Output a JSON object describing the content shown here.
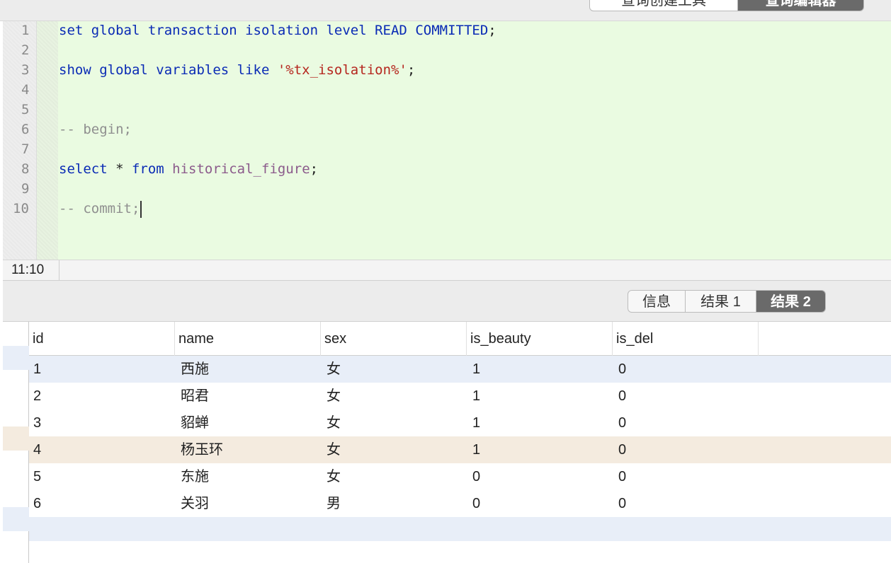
{
  "top_tabs": [
    {
      "label": "查询创建工具",
      "active": false
    },
    {
      "label": "查询编辑器",
      "active": true
    }
  ],
  "editor": {
    "line_numbers": [
      "1",
      "2",
      "3",
      "4",
      "5",
      "6",
      "7",
      "8",
      "9",
      "10"
    ],
    "lines": [
      [
        {
          "t": "set global transaction isolation level READ COMMITTED",
          "c": "kw"
        },
        {
          "t": ";",
          "c": "punc"
        }
      ],
      [],
      [
        {
          "t": "show global variables like ",
          "c": "kw"
        },
        {
          "t": "'%tx_isolation%'",
          "c": "str"
        },
        {
          "t": ";",
          "c": "punc"
        }
      ],
      [],
      [],
      [
        {
          "t": "-- begin;",
          "c": "cm"
        }
      ],
      [],
      [
        {
          "t": "select ",
          "c": "kw"
        },
        {
          "t": "* ",
          "c": "punc"
        },
        {
          "t": "from ",
          "c": "kw"
        },
        {
          "t": "historical_figure",
          "c": "id"
        },
        {
          "t": ";",
          "c": "punc"
        }
      ],
      [],
      [
        {
          "t": "-- commit;",
          "c": "cm"
        }
      ]
    ],
    "caret_line": 9
  },
  "status": {
    "cursor_position": "11:10"
  },
  "result_tabs": [
    {
      "label": "信息",
      "active": false
    },
    {
      "label": "结果 1",
      "active": false
    },
    {
      "label": "结果 2",
      "active": true
    }
  ],
  "results": {
    "columns": [
      "id",
      "name",
      "sex",
      "is_beauty",
      "is_del"
    ],
    "rows": [
      [
        "1",
        "西施",
        "女",
        "1",
        "0"
      ],
      [
        "2",
        "昭君",
        "女",
        "1",
        "0"
      ],
      [
        "3",
        "貂蝉",
        "女",
        "1",
        "0"
      ],
      [
        "4",
        "杨玉环",
        "女",
        "1",
        "0"
      ],
      [
        "5",
        "东施",
        "女",
        "0",
        "0"
      ],
      [
        "6",
        "关羽",
        "男",
        "0",
        "0"
      ]
    ],
    "selected_row": 0,
    "hovered_row": 3
  },
  "colors": {
    "editor_bg": "#eafbe1",
    "keyword": "#0a2bb5",
    "string": "#b5261e",
    "comment": "#8f8f8f",
    "identifier": "#8b5a8b",
    "selected_row_bg": "#e8eef8",
    "hover_row_bg": "#f4ebdf",
    "active_tab_bg": "#6a6a6a"
  }
}
